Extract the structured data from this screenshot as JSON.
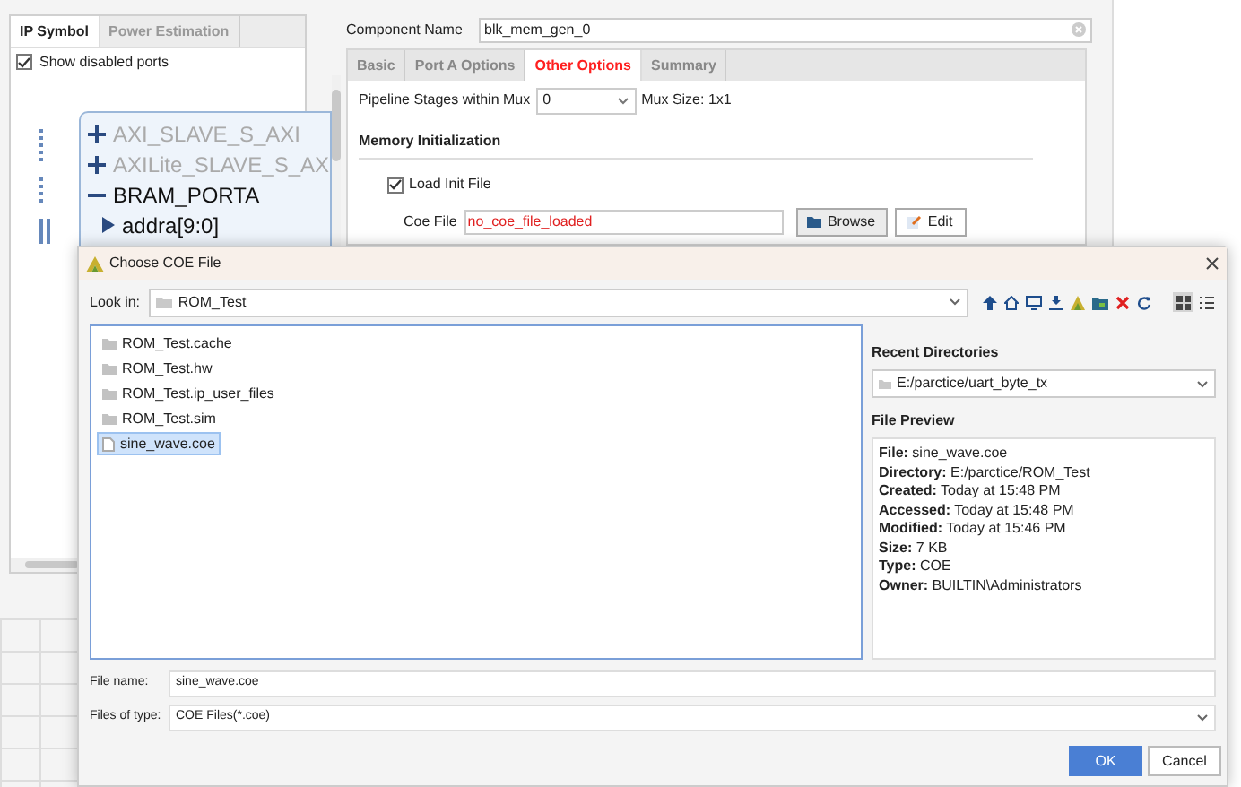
{
  "ip_panel": {
    "tabs": [
      {
        "label": "IP Symbol",
        "selected": true
      },
      {
        "label": "Power Estimation",
        "selected": false
      }
    ],
    "show_disabled_ports": {
      "label": "Show disabled ports",
      "checked": true
    },
    "ports": [
      {
        "kind": "bus",
        "label": "AXI_SLAVE_S_AXI",
        "expanded": false,
        "disabled": true
      },
      {
        "kind": "bus",
        "label": "AXILite_SLAVE_S_AX",
        "expanded": false,
        "disabled": true
      },
      {
        "kind": "bus",
        "label": "BRAM_PORTA",
        "expanded": true,
        "disabled": false
      },
      {
        "kind": "pin",
        "label": "addra[9:0]",
        "disabled": false
      }
    ]
  },
  "component_name": {
    "label": "Component Name",
    "value": "blk_mem_gen_0"
  },
  "tabs": [
    {
      "label": "Basic",
      "selected": false
    },
    {
      "label": "Port A Options",
      "selected": false
    },
    {
      "label": "Other Options",
      "selected": true
    },
    {
      "label": "Summary",
      "selected": false
    }
  ],
  "other_options": {
    "pipeline": {
      "label": "Pipeline Stages within Mux",
      "value": "0"
    },
    "mux_size": "Mux Size: 1x1",
    "section": "Memory Initialization",
    "load_init_file": {
      "label": "Load Init File",
      "checked": true
    },
    "coe_file": {
      "label": "Coe File",
      "value": "no_coe_file_loaded"
    },
    "buttons": [
      {
        "kind": "browse",
        "label": "Browse"
      },
      {
        "kind": "edit",
        "label": "Edit"
      }
    ]
  },
  "dialog": {
    "title": "Choose COE File",
    "look_in": {
      "label": "Look in:",
      "value": "ROM_Test"
    },
    "views": [
      {
        "kind": "grid",
        "selected": true
      },
      {
        "kind": "list",
        "selected": false
      }
    ],
    "files": [
      {
        "kind": "folder",
        "name": "ROM_Test.cache",
        "selected": false
      },
      {
        "kind": "folder",
        "name": "ROM_Test.hw",
        "selected": false
      },
      {
        "kind": "folder",
        "name": "ROM_Test.ip_user_files",
        "selected": false
      },
      {
        "kind": "folder",
        "name": "ROM_Test.sim",
        "selected": false
      },
      {
        "kind": "file",
        "name": "sine_wave.coe",
        "selected": true
      }
    ],
    "recent": {
      "label": "Recent Directories",
      "value": "E:/parctice/uart_byte_tx"
    },
    "preview": {
      "label": "File Preview",
      "lines": [
        "**File:** sine_wave.coe",
        "**Directory:** E:/parctice/ROM_Test",
        "**Created:** Today at 15:48 PM",
        "**Accessed:** Today at 15:48 PM",
        "**Modified:** Today at 15:46 PM",
        "**Size:** 7 KB",
        "**Type:** COE",
        "**Owner:** BUILTIN\\Administrators"
      ]
    },
    "file_name": {
      "label": "File name:",
      "value": "sine_wave.coe"
    },
    "file_type": {
      "label": "Files of type:",
      "value": "COE Files(*.coe)"
    },
    "buttons": [
      {
        "kind": "primary",
        "label": "OK"
      },
      {
        "kind": "secondary",
        "label": "Cancel"
      }
    ]
  }
}
